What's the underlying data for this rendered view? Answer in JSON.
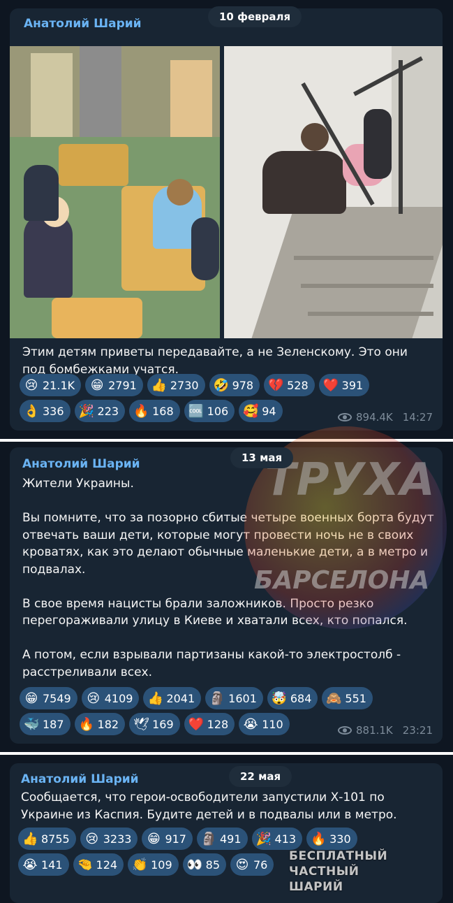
{
  "posts": [
    {
      "author": "Анатолий Шарий",
      "date": "10 февраля",
      "text": [
        "Этим детям приветы передавайте, а не Зеленскому. Это они под бомбежками учатся."
      ],
      "reactions": [
        [
          {
            "emoji": "😢",
            "count": "21.1K"
          },
          {
            "emoji": "😁",
            "count": "2791"
          },
          {
            "emoji": "👍",
            "count": "2730"
          },
          {
            "emoji": "🤣",
            "count": "978"
          },
          {
            "emoji": "💔",
            "count": "528"
          },
          {
            "emoji": "❤️",
            "count": "391"
          }
        ],
        [
          {
            "emoji": "👌",
            "count": "336"
          },
          {
            "emoji": "🎉",
            "count": "223"
          },
          {
            "emoji": "🔥",
            "count": "168"
          },
          {
            "emoji": "🆒",
            "count": "106"
          },
          {
            "emoji": "🥰",
            "count": "94"
          }
        ]
      ],
      "views": "894.4K",
      "time": "14:27"
    },
    {
      "author": "Анатолий Шарий",
      "date": "13 мая",
      "text": [
        "Жители Украины.",
        "",
        "Вы помните, что за позорно сбитые четыре военных борта будут отвечать ваши дети, которые могут провести ночь не в своих кроватях, как это делают обычные маленькие дети, а в метро и подвалах.",
        "",
        "В свое время нацисты брали заложников. Просто резко перегораживали улицу в Киеве и хватали всех, кто попался.",
        "",
        "А потом, если взрывали партизаны какой-то электростолб - расстреливали всех."
      ],
      "reactions": [
        [
          {
            "emoji": "😁",
            "count": "7549"
          },
          {
            "emoji": "😢",
            "count": "4109"
          },
          {
            "emoji": "👍",
            "count": "2041"
          },
          {
            "emoji": "🗿",
            "count": "1601"
          },
          {
            "emoji": "🤯",
            "count": "684"
          },
          {
            "emoji": "🙈",
            "count": "551"
          }
        ],
        [
          {
            "emoji": "🐳",
            "count": "187"
          },
          {
            "emoji": "🔥",
            "count": "182"
          },
          {
            "emoji": "🕊",
            "count": "169"
          },
          {
            "emoji": "❤️",
            "count": "128"
          },
          {
            "emoji": "😭",
            "count": "110"
          }
        ]
      ],
      "views": "881.1K",
      "time": "23:21"
    },
    {
      "author": "Анатолий Шарий",
      "date": "22 мая",
      "text": [
        "Сообщается, что герои-освободители запустили Х-101 по Украине из Каспия. Будите детей и в подвалы или в метро."
      ],
      "reactions": [
        [
          {
            "emoji": "👍",
            "count": "8755"
          },
          {
            "emoji": "😢",
            "count": "3233"
          },
          {
            "emoji": "😁",
            "count": "917"
          },
          {
            "emoji": "🗿",
            "count": "491"
          },
          {
            "emoji": "🎉",
            "count": "413"
          },
          {
            "emoji": "🔥",
            "count": "330"
          }
        ],
        [
          {
            "emoji": "😭",
            "count": "141"
          },
          {
            "emoji": "🤏",
            "count": "124"
          },
          {
            "emoji": "👏",
            "count": "109"
          },
          {
            "emoji": "👀",
            "count": "85"
          },
          {
            "emoji": "😍",
            "count": "76"
          }
        ]
      ]
    }
  ],
  "watermark": {
    "line1": "ТРУХА",
    "line2": "БАРСЕЛОНА"
  },
  "corner_watermark": {
    "line1": "БЕСПЛАТНЫЙ ЧАСТНЫЙ",
    "line2": "ШАРИЙ"
  },
  "colors": {
    "background": "#0e1621",
    "bubble": "#182533",
    "accent": "#6ab3f3",
    "reaction": "#2b5278"
  }
}
